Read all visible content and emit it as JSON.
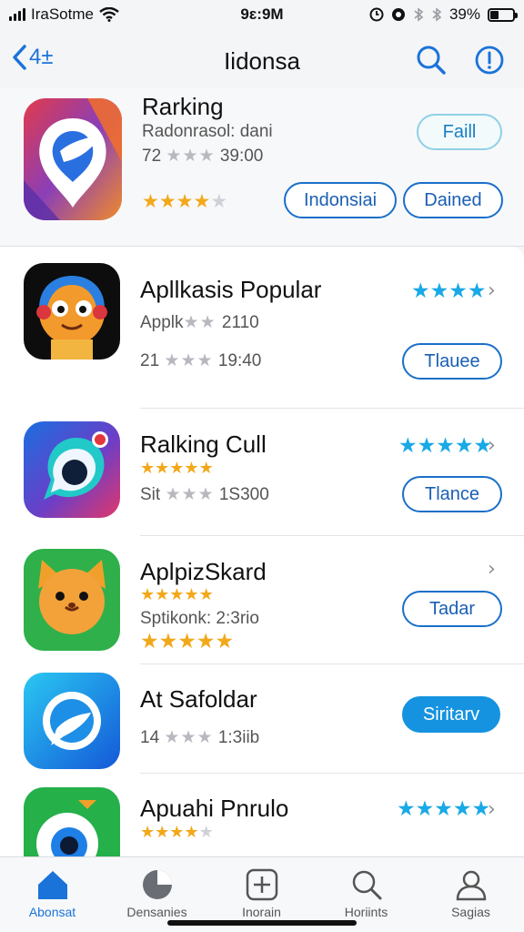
{
  "status": {
    "carrier": "IraSotme",
    "time": "9ɛ:9M",
    "battery": "39%",
    "battery_level": 0.39
  },
  "nav": {
    "back_label": "4±",
    "title": "Iidonsa"
  },
  "featured": {
    "title": "Rarking",
    "subtitle": "Radonrasol: dani",
    "meta_left": "72",
    "meta_right": "39:00",
    "rating": 3.5,
    "action": "Faill",
    "buttons": [
      "Indonsiai",
      "Dained"
    ]
  },
  "apps": [
    {
      "title": "Apllkasis Popular",
      "meta_left": "Applk",
      "meta_right": "2110",
      "meta2_left": "21",
      "meta2_right": "19:40",
      "blue_rating": 4,
      "action": "Tlauee"
    },
    {
      "title": "Ralking Cull",
      "rating": 4.5,
      "meta_left": "Sit",
      "meta_right": "1S300",
      "blue_rating": 5,
      "action": "Tlance"
    },
    {
      "title": "AplpizSkard",
      "rating": 4.5,
      "meta_left": "Sptikonk: 2:3rio",
      "rating2": 5,
      "action": "Tadar"
    },
    {
      "title": "At Safoldar",
      "meta_left": "14",
      "meta_right": "1:3iib",
      "action": "Siritarv"
    },
    {
      "title": "Apuahi Pnrulo",
      "rating": 4,
      "blue_rating": 5
    }
  ],
  "tabs": [
    {
      "label": "Abonsat",
      "icon": "home-icon"
    },
    {
      "label": "Densanies",
      "icon": "pie-chart-icon"
    },
    {
      "label": "Inorain",
      "icon": "add-square-icon"
    },
    {
      "label": "Horiints",
      "icon": "search-icon"
    },
    {
      "label": "Sagias",
      "icon": "person-icon"
    }
  ],
  "colors": {
    "accent": "#1a73d9",
    "star_gold": "#f2a81a",
    "star_blue": "#19a9e6",
    "button_fill": "#1593e0"
  }
}
